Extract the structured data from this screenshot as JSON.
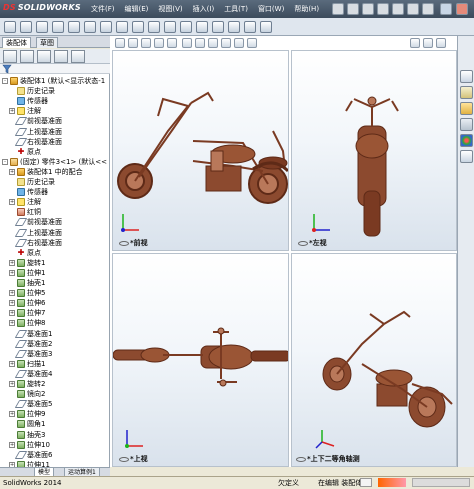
{
  "app": {
    "logo_text": "SOLIDWORKS",
    "logo_mark": "DS"
  },
  "menu": [
    {
      "label": "文件(F)"
    },
    {
      "label": "编辑(E)"
    },
    {
      "label": "视图(V)"
    },
    {
      "label": "插入(I)"
    },
    {
      "label": "工具(T)"
    },
    {
      "label": "窗口(W)"
    },
    {
      "label": "帮助(H)"
    }
  ],
  "left_panel": {
    "tabs": [
      "装配体",
      "草图"
    ],
    "bottom_tabs": [
      "模型",
      "运动算例1"
    ],
    "filter_icon": "filter-icon"
  },
  "tree": [
    {
      "label": "装配体1  (默认<显示状态-1",
      "icon": "asm",
      "level": 0,
      "exp": "-"
    },
    {
      "label": "历史记录",
      "icon": "hist",
      "level": 1
    },
    {
      "label": "传感器",
      "icon": "sensor",
      "level": 1
    },
    {
      "label": "注解",
      "icon": "note",
      "level": 1,
      "exp": "+"
    },
    {
      "label": "前视基准面",
      "icon": "plane",
      "level": 1
    },
    {
      "label": "上视基准面",
      "icon": "plane",
      "level": 1
    },
    {
      "label": "右视基准面",
      "icon": "plane",
      "level": 1
    },
    {
      "label": "原点",
      "icon": "origin",
      "level": 1
    },
    {
      "label": "(固定) 零件3<1> (默认<<",
      "icon": "part",
      "level": 0,
      "exp": "-"
    },
    {
      "label": "装配体1 中的配合",
      "icon": "asm",
      "level": 1,
      "exp": "+"
    },
    {
      "label": "历史记录",
      "icon": "hist",
      "level": 1
    },
    {
      "label": "传感器",
      "icon": "sensor",
      "level": 1
    },
    {
      "label": "注解",
      "icon": "note",
      "level": 1,
      "exp": "+"
    },
    {
      "label": "红铜",
      "icon": "mat",
      "level": 1
    },
    {
      "label": "前视基准面",
      "icon": "plane",
      "level": 1
    },
    {
      "label": "上视基准面",
      "icon": "plane",
      "level": 1
    },
    {
      "label": "右视基准面",
      "icon": "plane",
      "level": 1
    },
    {
      "label": "原点",
      "icon": "origin",
      "level": 1
    },
    {
      "label": "旋转1",
      "icon": "feat",
      "level": 1,
      "exp": "+"
    },
    {
      "label": "拉伸1",
      "icon": "feat",
      "level": 1,
      "exp": "+"
    },
    {
      "label": "抽壳1",
      "icon": "feat",
      "level": 1
    },
    {
      "label": "拉伸5",
      "icon": "feat",
      "level": 1,
      "exp": "+"
    },
    {
      "label": "拉伸6",
      "icon": "feat",
      "level": 1,
      "exp": "+"
    },
    {
      "label": "拉伸7",
      "icon": "feat",
      "level": 1,
      "exp": "+"
    },
    {
      "label": "拉伸8",
      "icon": "feat",
      "level": 1,
      "exp": "+"
    },
    {
      "label": "基准面1",
      "icon": "plane",
      "level": 1
    },
    {
      "label": "基准面2",
      "icon": "plane",
      "level": 1
    },
    {
      "label": "基准面3",
      "icon": "plane",
      "level": 1
    },
    {
      "label": "扫描1",
      "icon": "feat",
      "level": 1,
      "exp": "+"
    },
    {
      "label": "基准面4",
      "icon": "plane",
      "level": 1
    },
    {
      "label": "旋转2",
      "icon": "feat",
      "level": 1,
      "exp": "+"
    },
    {
      "label": "镜向2",
      "icon": "feat",
      "level": 1
    },
    {
      "label": "基准面5",
      "icon": "plane",
      "level": 1
    },
    {
      "label": "拉伸9",
      "icon": "feat",
      "level": 1,
      "exp": "+"
    },
    {
      "label": "圆角1",
      "icon": "feat",
      "level": 1
    },
    {
      "label": "抽壳3",
      "icon": "feat",
      "level": 1
    },
    {
      "label": "拉伸10",
      "icon": "feat",
      "level": 1,
      "exp": "+"
    },
    {
      "label": "基准面6",
      "icon": "plane",
      "level": 1
    },
    {
      "label": "拉伸11",
      "icon": "feat",
      "level": 1,
      "exp": "+"
    }
  ],
  "viewports": {
    "front": {
      "label": "*前视"
    },
    "left": {
      "label": "*左视"
    },
    "top": {
      "label": "*上视"
    },
    "iso": {
      "label": "*上下二等角轴测"
    }
  },
  "statusbar": {
    "app": "SolidWorks 2014",
    "state": "欠定义",
    "mode": "在编辑 装配体",
    "icon": "help-icon"
  },
  "colors": {
    "model_copper": "#7a3a22",
    "model_copper_light": "#b9785a",
    "menubar": "#4a5a6b"
  }
}
